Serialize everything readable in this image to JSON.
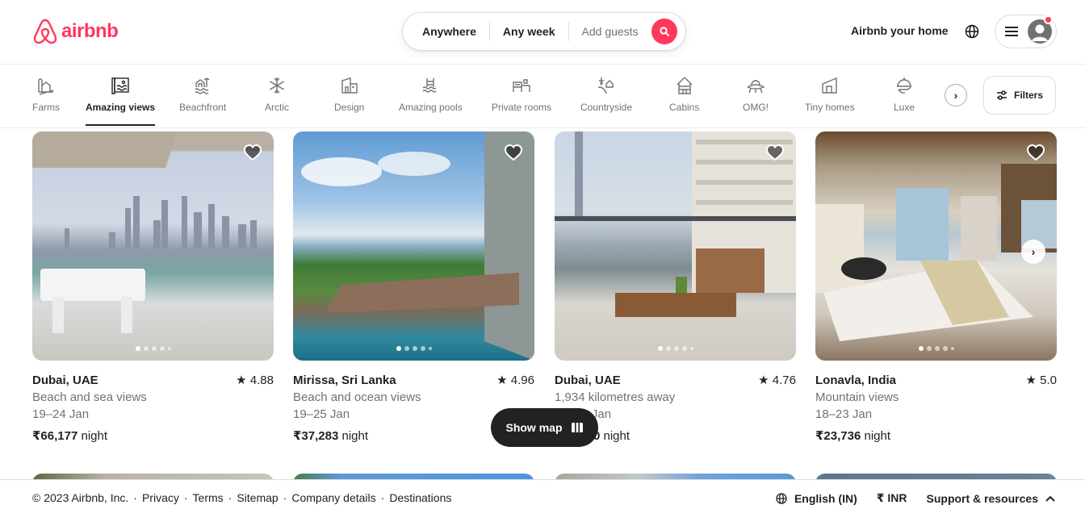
{
  "header": {
    "brand": "airbnb",
    "search": {
      "location": "Anywhere",
      "dates": "Any week",
      "guests_placeholder": "Add guests"
    },
    "host_link": "Airbnb your home",
    "icons": {
      "language": "globe-icon",
      "menu": "hamburger-icon",
      "profile": "avatar-icon",
      "search": "search-icon"
    }
  },
  "categories": {
    "active": "Amazing views",
    "items": [
      {
        "label": "Farms",
        "icon": "farm-icon"
      },
      {
        "label": "Amazing views",
        "icon": "amazing-views-icon"
      },
      {
        "label": "Beachfront",
        "icon": "beachfront-icon"
      },
      {
        "label": "Arctic",
        "icon": "snowflake-icon"
      },
      {
        "label": "Design",
        "icon": "design-icon"
      },
      {
        "label": "Amazing pools",
        "icon": "pool-icon"
      },
      {
        "label": "Private rooms",
        "icon": "private-room-icon"
      },
      {
        "label": "Countryside",
        "icon": "countryside-icon"
      },
      {
        "label": "Cabins",
        "icon": "cabin-icon"
      },
      {
        "label": "OMG!",
        "icon": "ufo-icon"
      },
      {
        "label": "Tiny homes",
        "icon": "tiny-home-icon"
      },
      {
        "label": "Luxe",
        "icon": "luxe-icon"
      }
    ],
    "filters_label": "Filters"
  },
  "listings": [
    {
      "location": "Dubai, UAE",
      "rating": "4.88",
      "description": "Beach and sea views",
      "dates": "19–24 Jan",
      "price": "₹66,177",
      "price_unit": "night"
    },
    {
      "location": "Mirissa, Sri Lanka",
      "rating": "4.96",
      "description": "Beach and ocean views",
      "dates": "19–25 Jan",
      "price": "₹37,283",
      "price_unit": "night"
    },
    {
      "location": "Dubai, UAE",
      "rating": "4.76",
      "description": "1,934 kilometres away",
      "dates": "19–23 Jan",
      "price": "₹45,000",
      "price_unit": "night"
    },
    {
      "location": "Lonavla, India",
      "rating": "5.0",
      "description": "Mountain views",
      "dates": "18–23 Jan",
      "price": "₹23,736",
      "price_unit": "night"
    }
  ],
  "show_map_label": "Show map",
  "footer": {
    "copyright": "© 2023 Airbnb, Inc.",
    "links": [
      "Privacy",
      "Terms",
      "Sitemap",
      "Company details",
      "Destinations"
    ],
    "language": "English (IN)",
    "currency_symbol": "₹",
    "currency": "INR",
    "support": "Support & resources"
  },
  "colors": {
    "brand": "#ff385c",
    "text": "#222222",
    "muted": "#717171"
  }
}
